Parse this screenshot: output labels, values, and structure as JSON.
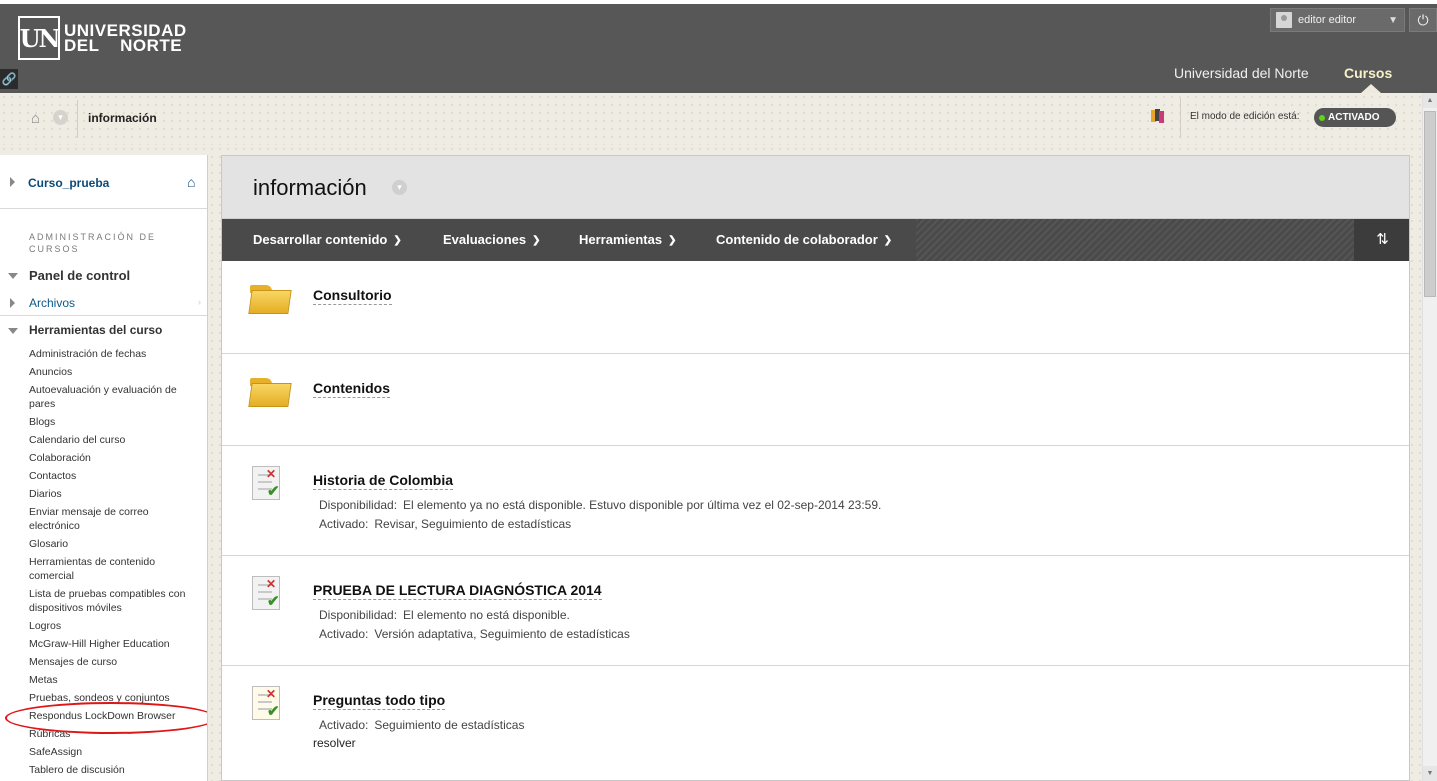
{
  "header": {
    "logo_mark": "UN",
    "logo_line1": "UNIVERSIDAD",
    "logo_line2": "DEL    NORTE",
    "user_name": "editor editor",
    "tab_institution": "Universidad del Norte",
    "tab_courses": "Cursos"
  },
  "breadcrumb": {
    "current": "información",
    "edit_mode_label": "El modo de edición está:",
    "edit_mode_value": "ACTIVADO"
  },
  "sidebar": {
    "course_name": "Curso_prueba",
    "admin_heading": "ADMINISTRACIÓN DE CURSOS",
    "panel_label": "Panel de control",
    "files_label": "Archivos",
    "tools_label": "Herramientas del curso",
    "tools": [
      "Administración de fechas",
      "Anuncios",
      "Autoevaluación y evaluación de pares",
      "Blogs",
      "Calendario del curso",
      "Colaboración",
      "Contactos",
      "Diarios",
      "Enviar mensaje de correo electrónico",
      "Glosario",
      "Herramientas de contenido comercial",
      "Lista de pruebas compatibles con dispositivos móviles",
      "Logros",
      "McGraw-Hill Higher Education",
      "Mensajes de curso",
      "Metas",
      "Pruebas, sondeos y conjuntos",
      "Respondus LockDown Browser",
      "Rúbricas",
      "SafeAssign",
      "Tablero de discusión"
    ]
  },
  "main": {
    "title": "información",
    "actions": [
      "Desarrollar contenido",
      "Evaluaciones",
      "Herramientas",
      "Contenido de colaborador"
    ],
    "items": [
      {
        "title": "Consultorio",
        "icon": "folder-icon"
      },
      {
        "title": "Contenidos",
        "icon": "folder-icon"
      },
      {
        "title": "Historia de Colombia",
        "icon": "test-icon",
        "meta": [
          {
            "key": "Disponibilidad:",
            "value": "El elemento ya no está disponible. Estuvo disponible por última vez el 02-sep-2014 23:59."
          },
          {
            "key": "Activado:",
            "value": "Revisar, Seguimiento de estadísticas"
          }
        ]
      },
      {
        "title": "PRUEBA DE LECTURA DIAGNÓSTICA 2014",
        "icon": "test-icon",
        "meta": [
          {
            "key": "Disponibilidad:",
            "value": "El elemento no está disponible."
          },
          {
            "key": "Activado:",
            "value": "Versión adaptativa, Seguimiento de estadísticas"
          }
        ]
      },
      {
        "title": "Preguntas todo tipo",
        "icon": "test-icon",
        "meta": [
          {
            "key": "Activado:",
            "value": "Seguimiento de estadísticas"
          }
        ],
        "extra": "resolver"
      }
    ]
  },
  "colors": {
    "header_bg": "#575757",
    "active_tab": "#f7f2c8",
    "link": "#0c4a7a",
    "edit_on": "#59d61b",
    "annotation": "#e01515"
  }
}
